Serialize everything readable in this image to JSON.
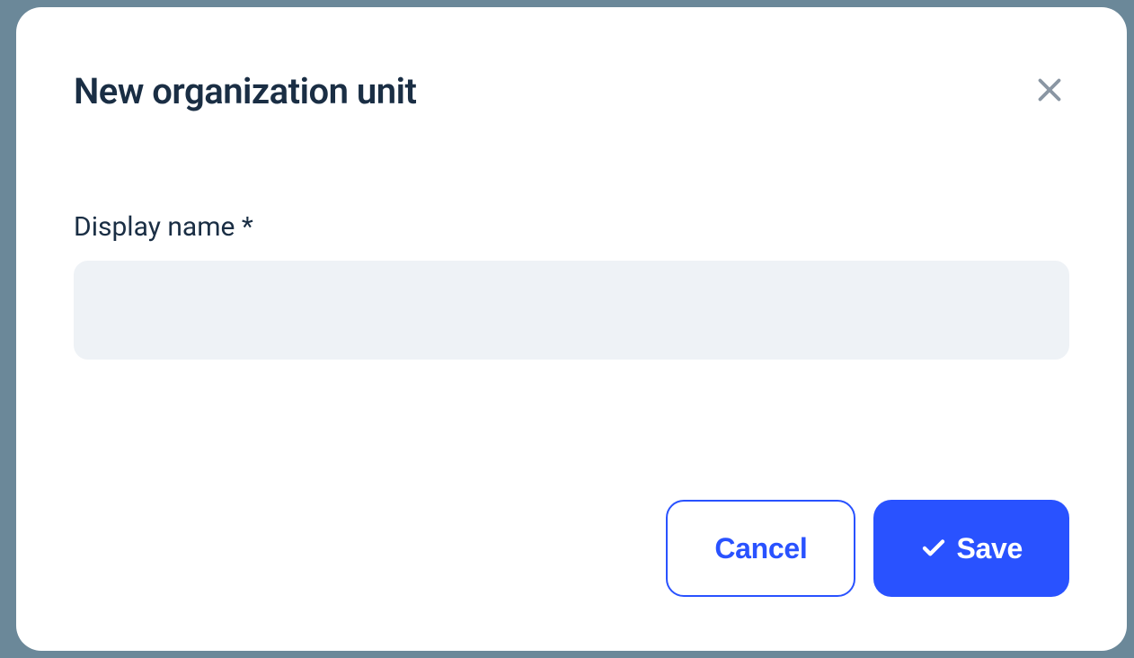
{
  "modal": {
    "title": "New organization unit",
    "form": {
      "displayName": {
        "label": "Display name *",
        "value": ""
      }
    },
    "buttons": {
      "cancel": "Cancel",
      "save": "Save"
    }
  }
}
